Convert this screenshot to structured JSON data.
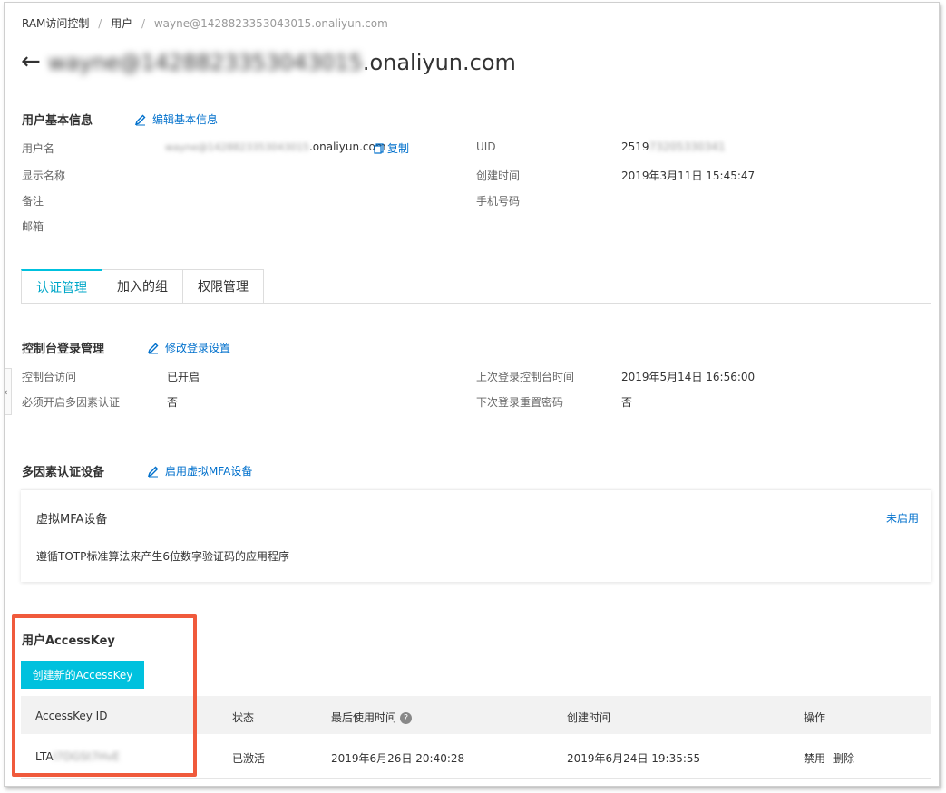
{
  "breadcrumb": {
    "items": [
      "RAM访问控制",
      "用户"
    ],
    "current": "wayne@1428823353043015.onaliyun.com",
    "sep": "/"
  },
  "page_title": {
    "blurred": "wayne@1428823353043015",
    "suffix": ".onaliyun.com"
  },
  "basic_info": {
    "title": "用户基本信息",
    "edit_label": "编辑基本信息",
    "labels": {
      "username": "用户名",
      "display_name": "显示名称",
      "remark": "备注",
      "email": "邮箱",
      "uid": "UID",
      "created": "创建时间",
      "phone": "手机号码"
    },
    "username_blurred": "wayne@1428823353043015",
    "username_suffix": ".onaliyun.com",
    "copy_label": "复制",
    "uid_prefix": "2519",
    "uid_blurred": "73205330341",
    "created_value": "2019年3月11日 15:45:47"
  },
  "tabs": [
    "认证管理",
    "加入的组",
    "权限管理"
  ],
  "console_login": {
    "title": "控制台登录管理",
    "edit_label": "修改登录设置",
    "labels": {
      "console_access": "控制台访问",
      "mfa_required": "必须开启多因素认证",
      "last_login": "上次登录控制台时间",
      "reset_pwd": "下次登录重置密码"
    },
    "values": {
      "console_access": "已开启",
      "mfa_required": "否",
      "last_login": "2019年5月14日 16:56:00",
      "reset_pwd": "否"
    }
  },
  "mfa": {
    "title": "多因素认证设备",
    "enable_label": "启用虚拟MFA设备",
    "card_title": "虚拟MFA设备",
    "card_desc": "遵循TOTP标准算法来产生6位数字验证码的应用程序",
    "status": "未启用"
  },
  "access_key": {
    "title": "用户AccessKey",
    "create_label": "创建新的AccessKey",
    "columns": [
      "AccessKey ID",
      "状态",
      "最后使用时间",
      "创建时间",
      "操作"
    ],
    "row": {
      "id_prefix": "LTA",
      "id_blurred": "I7DGSt7HvE",
      "status": "已激活",
      "last_used": "2019年6月26日 20:40:28",
      "created": "2019年6月24日 19:35:55",
      "action_disable": "禁用",
      "action_delete": "删除"
    }
  },
  "colors": {
    "accent": "#00c1de",
    "link": "#0070cc",
    "highlight_box": "#f05a3c"
  }
}
